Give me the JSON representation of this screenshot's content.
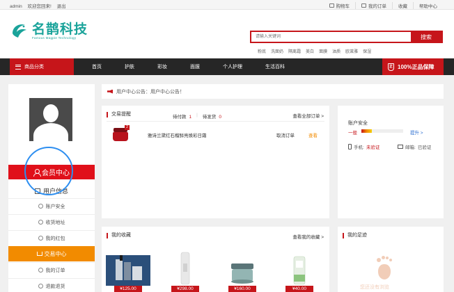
{
  "topbar": {
    "user": "admin",
    "welcome": "欢迎您回来!",
    "logout": "退出",
    "links": [
      "购物车",
      "我的订单",
      "收藏",
      "帮助中心"
    ]
  },
  "header": {
    "logo_cn": "名鹊科技",
    "logo_en": "Famous Magpie Technology",
    "search_placeholder": "请输入关键词",
    "search_button": "搜索",
    "hotwords": [
      "粉底",
      "洗面奶",
      "隔离霜",
      "美白",
      "面膜",
      "油质",
      "欧莱雅",
      "保湿"
    ]
  },
  "nav": {
    "category": "商品分类",
    "links": [
      "首页",
      "护肤",
      "彩妆",
      "面膜",
      "个人护理",
      "生活百科"
    ],
    "promo": "100%正品保障"
  },
  "sidebar": {
    "member_center": "会员中心",
    "user_info": "用户信息",
    "account_security": "账户安全",
    "address": "收货地址",
    "red_packet": "我的红包",
    "trade_center": "交易中心",
    "my_orders": "我的订单",
    "refund": "退款退货"
  },
  "notice": {
    "text": "用户中心公告：用户中心公告！"
  },
  "trade_panel": {
    "title": "交易提醒",
    "pay_label": "待付款",
    "pay_count": "1",
    "ship_label": "待发货",
    "ship_count": "0",
    "more": "查看全部订单 >",
    "badge": "2",
    "product_name": "雅诗兰黛红石榴鲜亮焕彩日霜",
    "cancel": "取消订单",
    "view": "查看"
  },
  "account_panel": {
    "title": "账户安全",
    "level": "一般",
    "level_fraction": 0.25,
    "upgrade": "提升 >",
    "phone_label": "手机:",
    "phone_status": "未验证",
    "email_label": "邮箱:",
    "email_status": "已验证"
  },
  "fav_panel": {
    "title": "我的收藏",
    "more": "查看我的收藏 >",
    "prices": [
      "¥125.00",
      "¥298.00",
      "¥160.00",
      "¥40.00"
    ]
  },
  "footprint_panel": {
    "title": "我的足迹",
    "hint": "您还没有浏览"
  },
  "colors": {
    "brand_red": "#c6151a",
    "brand_teal": "#1aa39a",
    "orange": "#f28b00",
    "nav_dark": "#262626"
  }
}
